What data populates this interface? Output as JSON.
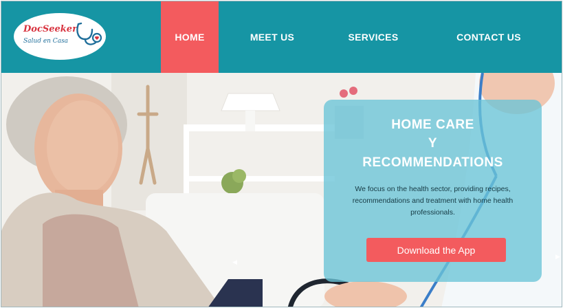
{
  "brand": {
    "name": "DocSeeker",
    "tagline": "Salud en Casa"
  },
  "nav": {
    "items": [
      {
        "label": "HOME",
        "active": true
      },
      {
        "label": "MEET US",
        "active": false
      },
      {
        "label": "SERVICES",
        "active": false
      },
      {
        "label": "CONTACT US",
        "active": false
      }
    ]
  },
  "hero": {
    "title_line1": "HOME CARE",
    "title_line2": "Y",
    "title_line3": "RECOMMENDATIONS",
    "description": "We focus on the health sector, providing recipes, recommendations and treatment with home health professionals.",
    "cta_label": "Download the App",
    "background_image": "elderly-woman-and-doctor-photo"
  },
  "colors": {
    "header_bg": "#1695a4",
    "accent": "#f35b5e",
    "panel_overlay": "#6ac4d7",
    "brand_red": "#d8333f",
    "brand_blue": "#1f6e9a"
  },
  "icons": {
    "logo_mark": "stethoscope-heart-icon",
    "slider_prev": "chevron-left-icon",
    "slider_next": "chevron-right-icon"
  }
}
